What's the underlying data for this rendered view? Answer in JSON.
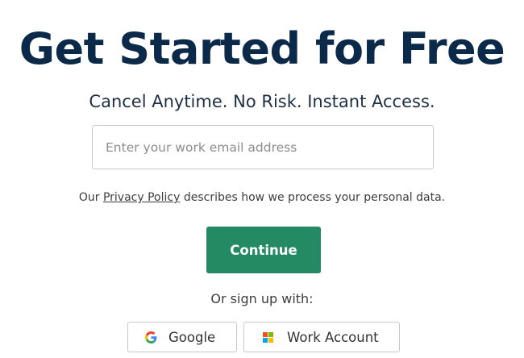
{
  "signup": {
    "title": "Get Started for Free",
    "subtitle": "Cancel Anytime. No Risk. Instant Access.",
    "email_placeholder": "Enter your work email address",
    "email_value": "",
    "privacy_prefix": "Our ",
    "privacy_link": "Privacy Policy",
    "privacy_suffix": " describes how we process your personal data.",
    "continue_label": "Continue",
    "or_text": "Or sign up with:"
  },
  "social": {
    "google_label": "Google",
    "google_icon": "google-icon",
    "work_label": "Work Account",
    "work_icon": "microsoft-icon"
  },
  "colors": {
    "title": "#0b2a4a",
    "continue_button": "#248a63",
    "google_blue": "#4285f4",
    "google_red": "#ea4335",
    "google_yellow": "#fbbc05",
    "google_green": "#34a853",
    "ms_red": "#f25022",
    "ms_green": "#7fba00",
    "ms_blue": "#00a4ef",
    "ms_yellow": "#ffb900"
  }
}
